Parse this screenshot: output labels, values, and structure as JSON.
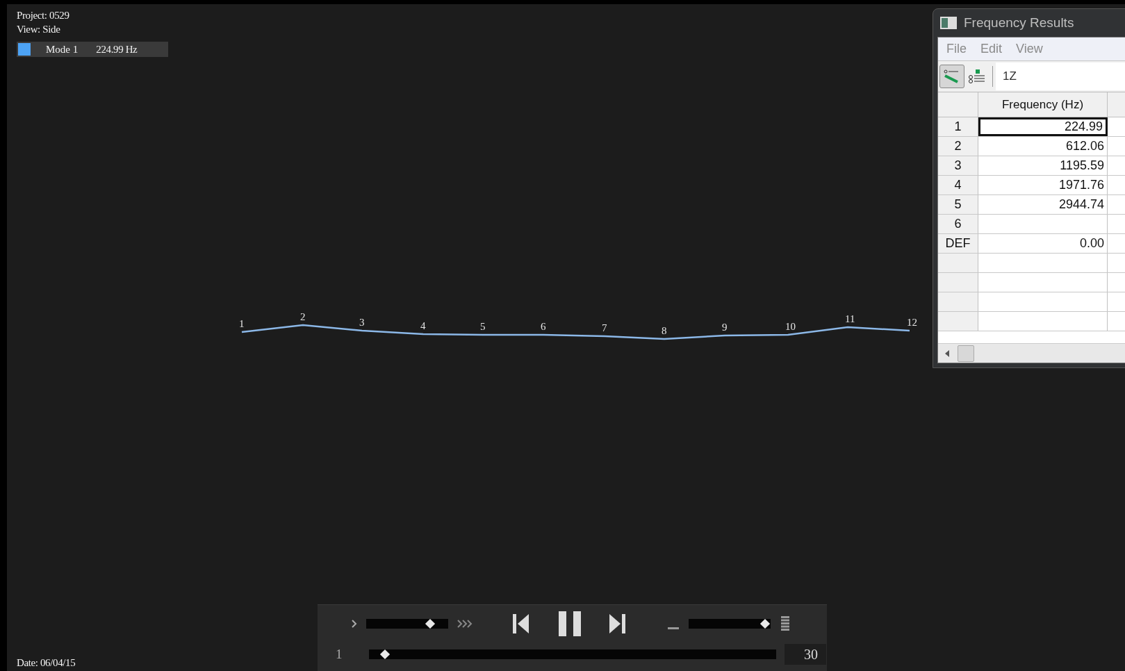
{
  "info": {
    "project": "Project: 0529",
    "view": "View: Side"
  },
  "legend": {
    "color": "#4da3f5",
    "mode": "Mode 1",
    "frequency": "224.99 Hz"
  },
  "nodes": [
    {
      "label": "1"
    },
    {
      "label": "2"
    },
    {
      "label": "3"
    },
    {
      "label": "4"
    },
    {
      "label": "5"
    },
    {
      "label": "6"
    },
    {
      "label": "7"
    },
    {
      "label": "8"
    },
    {
      "label": "9"
    },
    {
      "label": "10"
    },
    {
      "label": "11"
    },
    {
      "label": "12"
    }
  ],
  "date": "Date: 06/04/15",
  "player": {
    "speed": {
      "level": 0.78
    },
    "volume": {
      "level": 0.93
    },
    "frame": {
      "level": 0.04
    },
    "frame_start": "1",
    "frame_end": "30",
    "playing": true
  },
  "window": {
    "title": "Frequency Results",
    "menu": [
      "File",
      "Edit",
      "View"
    ],
    "toolbar": [
      {
        "kind": "mode-shape",
        "pressed": true
      },
      {
        "kind": "list",
        "pressed": false
      }
    ],
    "field": "1Z",
    "table": {
      "column": "Frequency (Hz)",
      "rows": [
        {
          "id": "1",
          "value": "224.99",
          "selected": true
        },
        {
          "id": "2",
          "value": "612.06",
          "selected": false
        },
        {
          "id": "3",
          "value": "1195.59",
          "selected": false
        },
        {
          "id": "4",
          "value": "1971.76",
          "selected": false
        },
        {
          "id": "5",
          "value": "2944.74",
          "selected": false
        },
        {
          "id": "6",
          "value": "",
          "selected": false
        },
        {
          "id": "DEF",
          "value": "0.00",
          "selected": false
        }
      ]
    }
  }
}
